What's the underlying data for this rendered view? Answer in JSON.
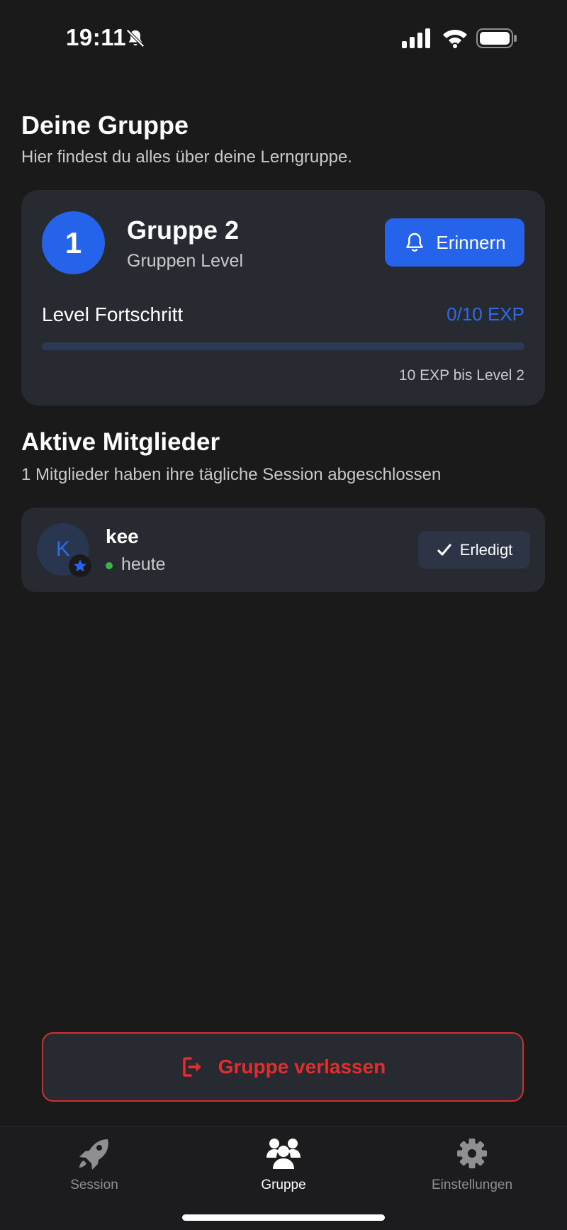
{
  "status_bar": {
    "time": "19:11"
  },
  "header": {
    "title": "Deine Gruppe",
    "subtitle": "Hier findest du alles über deine Lerngruppe."
  },
  "group": {
    "level": "1",
    "name": "Gruppe 2",
    "level_label": "Gruppen Level",
    "remind_label": "Erinnern",
    "progress_label": "Level Fortschritt",
    "progress_value": "0/10 EXP",
    "progress_fraction": 0,
    "remaining": "10 EXP bis Level 2"
  },
  "members": {
    "title": "Aktive Mitglieder",
    "subtitle": "1 Mitglieder haben ihre tägliche Session abgeschlossen",
    "items": [
      {
        "initial": "K",
        "name": "kee",
        "last_active": "heute",
        "status": "Erledigt"
      }
    ]
  },
  "leave_label": "Gruppe verlassen",
  "tabs": [
    {
      "label": "Session",
      "icon": "rocket-icon",
      "active": false
    },
    {
      "label": "Gruppe",
      "icon": "group-icon",
      "active": true
    },
    {
      "label": "Einstellungen",
      "icon": "gear-icon",
      "active": false
    }
  ],
  "colors": {
    "accent": "#2563eb",
    "danger": "#e02d2d",
    "background": "#1a1a1b",
    "card": "#272b31"
  }
}
